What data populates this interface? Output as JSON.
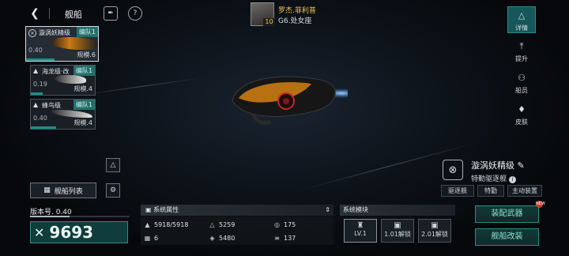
{
  "header": {
    "title": "舰船"
  },
  "commander": {
    "name": "罗杰.菲利普",
    "position": "G6.处女座",
    "level": "10"
  },
  "fleet": [
    {
      "name": "漩涡妖精级",
      "tag": "编队1",
      "power": "0.40",
      "scale": "规模.6",
      "progress": 0.4,
      "selected": true
    },
    {
      "name": "海龙级·改",
      "tag": "编队1",
      "power": "0.19",
      "scale": "规模.4",
      "progress": 0.19,
      "selected": false
    },
    {
      "name": "蜂鸟级",
      "tag": "编队1",
      "power": "0.40",
      "scale": "规模.4",
      "progress": 0.4,
      "selected": false
    }
  ],
  "right_nav": [
    {
      "label": "详情",
      "icon": "details-icon",
      "active": true
    },
    {
      "label": "提升",
      "icon": "upgrade-icon",
      "active": false
    },
    {
      "label": "船员",
      "icon": "crew-icon",
      "active": false
    },
    {
      "label": "皮肤",
      "icon": "skin-icon",
      "active": false
    }
  ],
  "ship_info": {
    "name": "漩涡妖精级",
    "type": "特勤驱逐舰"
  },
  "tabs": [
    "驱逐舰",
    "特勤",
    "主动装置"
  ],
  "ship_list_button": "舰船列表",
  "version": {
    "label": "版本号. 0.40",
    "progress": 0.4
  },
  "combat_power": "9693",
  "system_attributes": {
    "title": "系统属性",
    "stats": [
      {
        "icon": "hull-icon",
        "value": "5918/5918"
      },
      {
        "icon": "armor-icon",
        "value": "5259"
      },
      {
        "icon": "shield-icon",
        "value": "175"
      },
      {
        "icon": "weapon-icon",
        "value": "6"
      },
      {
        "icon": "speed-icon",
        "value": "5480"
      },
      {
        "icon": "range-icon",
        "value": "137"
      }
    ]
  },
  "system_modules": {
    "title": "系统模块",
    "slots": [
      {
        "label": "LV.1",
        "locked": false
      },
      {
        "label": "1.01解锁",
        "locked": true
      },
      {
        "label": "2.01解锁",
        "locked": true
      }
    ]
  },
  "actions": {
    "equip": "装配武器",
    "refit": "舰船改装",
    "new_badge": "NEW"
  },
  "colors": {
    "accent": "#1c8f8a",
    "highlight": "#f1c34a",
    "engine_glow": "#3a8fff",
    "ship_orange": "#c97a12"
  }
}
